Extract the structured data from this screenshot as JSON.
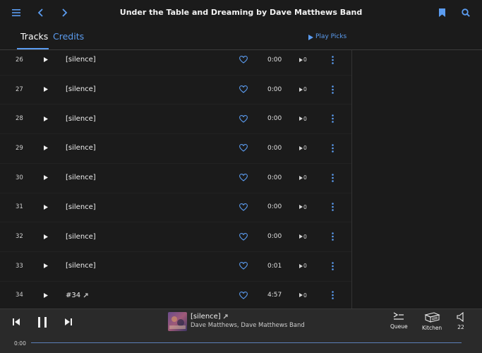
{
  "header": {
    "title": "Under the Table and Dreaming by Dave Matthews Band"
  },
  "tabs": {
    "tracks": "Tracks",
    "credits": "Credits",
    "play_picks": "Play Picks"
  },
  "tracks": [
    {
      "number": "26",
      "name": "[silence]",
      "duration": "0:00",
      "plays": "0",
      "link": false
    },
    {
      "number": "27",
      "name": "[silence]",
      "duration": "0:00",
      "plays": "0",
      "link": false
    },
    {
      "number": "28",
      "name": "[silence]",
      "duration": "0:00",
      "plays": "0",
      "link": false
    },
    {
      "number": "29",
      "name": "[silence]",
      "duration": "0:00",
      "plays": "0",
      "link": false
    },
    {
      "number": "30",
      "name": "[silence]",
      "duration": "0:00",
      "plays": "0",
      "link": false
    },
    {
      "number": "31",
      "name": "[silence]",
      "duration": "0:00",
      "plays": "0",
      "link": false
    },
    {
      "number": "32",
      "name": "[silence]",
      "duration": "0:00",
      "plays": "0",
      "link": false
    },
    {
      "number": "33",
      "name": "[silence]",
      "duration": "0:01",
      "plays": "0",
      "link": false
    },
    {
      "number": "34",
      "name": "#34",
      "duration": "4:57",
      "plays": "0",
      "link": true
    }
  ],
  "now_playing": {
    "title": "[silence]",
    "artist": "Dave Matthews, Dave Matthews Band",
    "elapsed": "0:00"
  },
  "outputs": {
    "queue": "Queue",
    "zone": "Kitchen",
    "volume": "22"
  },
  "colors": {
    "accent": "#5b9cf0",
    "background": "#1b1b1b",
    "player_bar": "#2a2a2a"
  },
  "icons": {
    "menu": "menu-icon",
    "back": "chevron-left-icon",
    "forward": "chevron-right-icon",
    "bookmark": "bookmark-icon",
    "search": "search-icon",
    "play": "play-icon",
    "heart": "heart-icon",
    "more": "more-vertical-icon",
    "link": "link-icon"
  }
}
